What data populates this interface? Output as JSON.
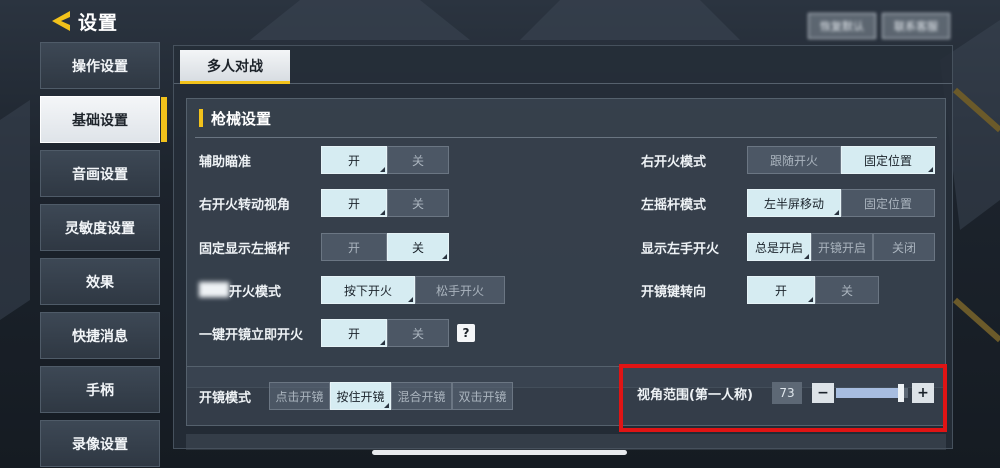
{
  "header": {
    "title": "设置",
    "top_buttons": [
      "恢复默认",
      "联系客服"
    ]
  },
  "sidebar": {
    "items": [
      {
        "label": "操作设置",
        "active": false
      },
      {
        "label": "基础设置",
        "active": true
      },
      {
        "label": "音画设置",
        "active": false
      },
      {
        "label": "灵敏度设置",
        "active": false
      },
      {
        "label": "效果",
        "active": false
      },
      {
        "label": "快捷消息",
        "active": false
      },
      {
        "label": "手柄",
        "active": false
      },
      {
        "label": "录像设置",
        "active": false
      }
    ]
  },
  "tabs": [
    {
      "label": "多人对战",
      "active": true
    }
  ],
  "weapon_settings": {
    "title": "枪械设置",
    "left": [
      {
        "label": "辅助瞄准",
        "options": [
          "开",
          "关"
        ],
        "selected": 0
      },
      {
        "label": "右开火转动视角",
        "options": [
          "开",
          "关"
        ],
        "selected": 0
      },
      {
        "label": "固定显示左摇杆",
        "options": [
          "开",
          "关"
        ],
        "selected": 1
      },
      {
        "label": "开火模式",
        "options": [
          "按下开火",
          "松手开火"
        ],
        "selected": 0
      },
      {
        "label": "一键开镜立即开火",
        "options": [
          "开",
          "关"
        ],
        "selected": 0
      }
    ],
    "help_glyph": "?",
    "right": [
      {
        "label": "右开火模式",
        "options": [
          "跟随开火",
          "固定位置"
        ],
        "selected": 1
      },
      {
        "label": "左摇杆模式",
        "options": [
          "左半屏移动",
          "固定位置"
        ],
        "selected": 0
      },
      {
        "label": "显示左手开火",
        "options": [
          "总是开启",
          "开镜开启",
          "关闭"
        ],
        "selected": 0
      },
      {
        "label": "开镜键转向",
        "options": [
          "开",
          "关"
        ],
        "selected": 0
      }
    ]
  },
  "scope_mode": {
    "label": "开镜模式",
    "options": [
      "点击开镜",
      "按住开镜",
      "混合开镜",
      "双击开镜"
    ],
    "selected": 1
  },
  "fov": {
    "label": "视角范围(第一人称)",
    "value": "73",
    "minus": "−",
    "plus": "+",
    "fraction": 0.9
  },
  "colors": {
    "accent": "#f2c21b",
    "highlight": "#e01414",
    "selected_bg": "#d6ecf2"
  }
}
